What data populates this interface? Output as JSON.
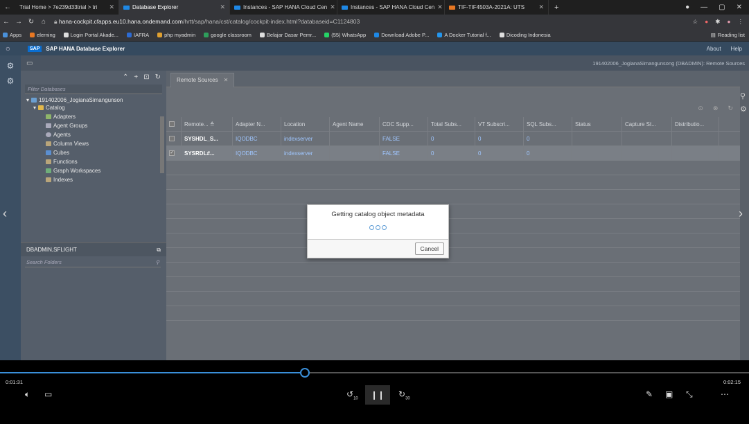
{
  "browser": {
    "tabs": [
      {
        "label": "Trial Home > 7e239d33trial > tri"
      },
      {
        "label": "Database Explorer"
      },
      {
        "label": "Instances - SAP HANA Cloud Cen"
      },
      {
        "label": "Instances - SAP HANA Cloud Cen"
      },
      {
        "label": "TIF-TIF4503A-2021A: UTS"
      }
    ],
    "url_host": "hana-cockpit.cfapps.eu10.hana.ondemand.com",
    "url_path": "/hrtt/sap/hana/cst/catalog/cockpit-index.html?databaseid=C1124803",
    "bookmarks": [
      "Apps",
      "elerning",
      "Login Portal Akade...",
      "IAFRA",
      "php myadmin",
      "google classroom",
      "Belajar Dasar Pemr...",
      "(55) WhatsApp",
      "Download Adobe P...",
      "A Docker Tutorial f...",
      "Dicoding Indonesia"
    ],
    "reading_list": "Reading list"
  },
  "app": {
    "logo": "SAP",
    "title": "SAP HANA Database Explorer",
    "about": "About",
    "help": "Help",
    "breadcrumb": "191402006_JogianaSimangunsong (DBADMIN): Remote Sources"
  },
  "left_pane": {
    "filter_placeholder": "Filter Databases",
    "db_name": "191402006_JogianaSimangunson",
    "catalog": "Catalog",
    "tree_items": [
      "Adapters",
      "Agent Groups",
      "Agents",
      "Column Views",
      "Cubes",
      "Functions",
      "Graph Workspaces",
      "Indexes"
    ],
    "schema": "DBADMIN,SFLIGHT",
    "search_placeholder": "Search Folders"
  },
  "main": {
    "tab_label": "Remote Sources",
    "columns": [
      "Remote...",
      "Adapter N...",
      "Location",
      "Agent Name",
      "CDC Supp...",
      "Total Subs...",
      "VT Subscri...",
      "SQL Subs...",
      "Status",
      "Capture St...",
      "Distributio..."
    ],
    "rows": [
      {
        "checked": false,
        "name": "SYSHDL_S...",
        "adapter": "IQODBC",
        "location": "indexserver",
        "agent": "",
        "cdc": "FALSE",
        "total": "0",
        "vt": "0",
        "sql": "0"
      },
      {
        "checked": true,
        "name": "SYSRDL#...",
        "adapter": "IQODBC",
        "location": "indexserver",
        "agent": "",
        "cdc": "FALSE",
        "total": "0",
        "vt": "0",
        "sql": "0"
      }
    ]
  },
  "dialog": {
    "title": "Getting catalog object metadata",
    "cancel": "Cancel"
  },
  "player": {
    "current_time": "0:01:31",
    "total_time": "0:02:15",
    "progress": 0.407,
    "rewind_label": "10",
    "forward_label": "30"
  }
}
